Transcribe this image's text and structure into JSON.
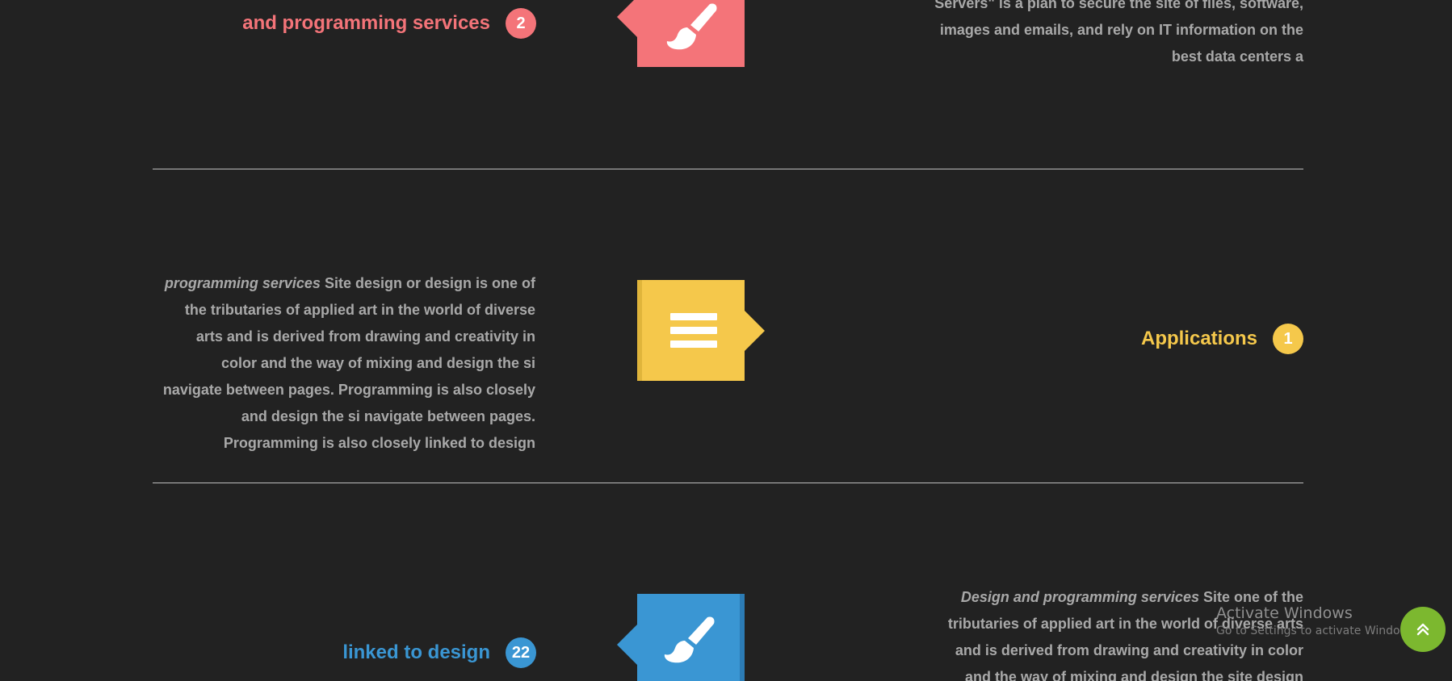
{
  "colors": {
    "background": "#222222",
    "body_text": "#a9a9a9",
    "pink": "#f47479",
    "yellow": "#f5c84b",
    "blue": "#3a96d3",
    "green": "#7cb82f"
  },
  "section_1": {
    "title": "and programming services",
    "badge": "2",
    "icon": "paintbrush-icon",
    "text_lines": [
      "Servers\" is a plan to secure the site of files, software,",
      "images and emails, and rely on IT information on the",
      "best data centers a"
    ]
  },
  "section_2": {
    "title": "Applications",
    "badge": "1",
    "icon": "menu-icon",
    "text_lead": "programming services",
    "text_line1_rest": "Site design or design is one of",
    "text_lines": [
      "the tributaries of applied art in the world of diverse",
      "arts and is derived from drawing and creativity in",
      "color and the way of mixing and design the si",
      "navigate between pages. Programming is also closely",
      "and design the si navigate between pages.",
      "Programming is also closely linked to design"
    ]
  },
  "section_3": {
    "title": "linked to design",
    "badge": "22",
    "icon": "paintbrush-icon",
    "text_lead": "Design and programming services",
    "text_line1_rest": "Site one of the",
    "text_lines": [
      "tributaries of applied art in the world of diverse arts",
      "and is derived from drawing and creativity in color",
      "and the way of mixing and design the site design"
    ]
  },
  "os_overlay": {
    "title": "Activate Windows",
    "subtitle": "Go to Settings to activate Windows."
  },
  "scroll_top": {
    "icon": "double-chevron-up-icon"
  }
}
